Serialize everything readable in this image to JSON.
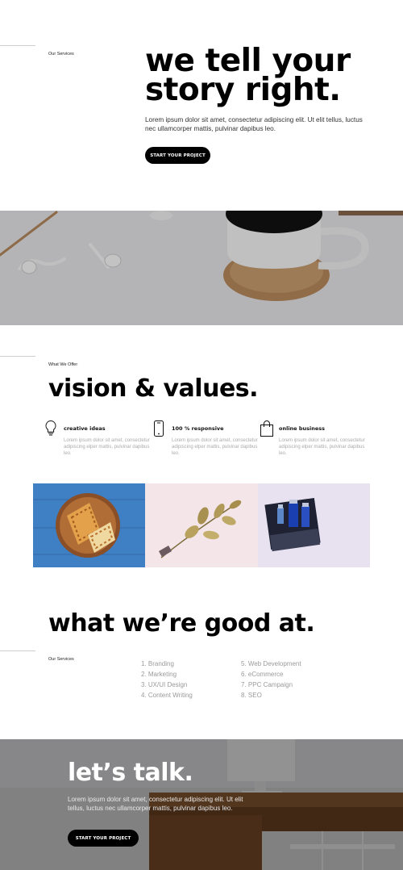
{
  "hero": {
    "eyebrow": "Our Services",
    "title_line1": "we tell your",
    "title_line2": "story right.",
    "text": "Lorem ipsum dolor sit amet, consectetur adipiscing elit. Ut elit tellus, luctus nec ullamcorper mattis, pulvinar dapibus leo.",
    "cta": "START YOUR PROJECT"
  },
  "vision": {
    "eyebrow": "What We Offer",
    "title": "vision & values.",
    "features": [
      {
        "title": "creative ideas",
        "text": "Lorem ipsum dolor sit amet, consectetur adipiscing elper mattis, pulvinar dapibus leo.",
        "icon": "lightbulb-icon"
      },
      {
        "title": "100 % responsive",
        "text": "Lorem ipsum dolor sit amet, consectetur adipiscing elper mattis, pulvinar dapibus leo.",
        "icon": "smartphone-icon"
      },
      {
        "title": "online business",
        "text": "Lorem ipsum dolor sit amet, consectetur adipiscing elper mattis, pulvinar dapibus leo.",
        "icon": "shopping-bag-icon"
      }
    ]
  },
  "services": {
    "title": "what we’re good at.",
    "eyebrow": "Our Services",
    "col1": [
      "1. Branding",
      "2. Marketing",
      "3. UX/UI Design",
      "4. Content Writing"
    ],
    "col2": [
      "5. Web Development",
      "6. eCommerce",
      "7. PPC Campaign",
      "8. SEO"
    ]
  },
  "contact": {
    "title": "let’s talk.",
    "text": "Lorem ipsum dolor sit amet, consectetur adipiscing elit. Ut elit tellus, luctus nec ullamcorper mattis, pulvinar dapibus leo.",
    "cta": "START YOUR PROJECT"
  },
  "colors": {
    "accent": "#000000",
    "muted_text": "#9a9a9a",
    "gallery_blue": "#3f7fc4",
    "gallery_pink": "#f3e5e8",
    "gallery_lavender": "#e8e1f0"
  }
}
